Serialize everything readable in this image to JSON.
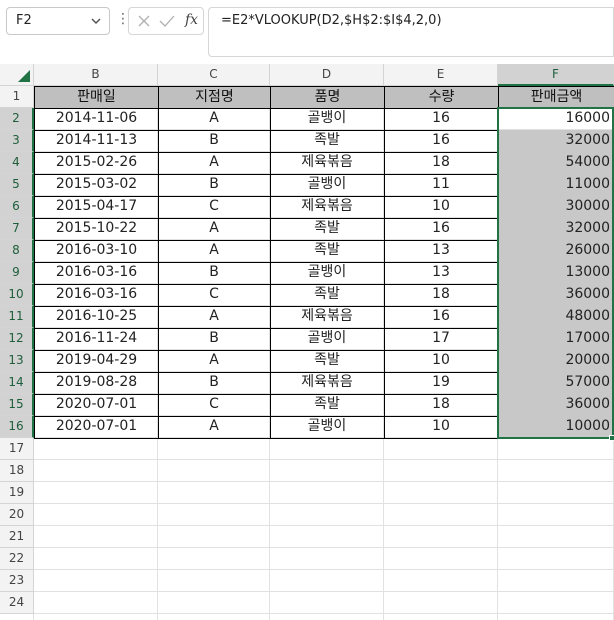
{
  "formula_bar": {
    "name_box": "F2",
    "fx": "fx",
    "formula": "=E2*VLOOKUP(D2,$H$2:$I$4,2,0)"
  },
  "columns": [
    "B",
    "C",
    "D",
    "E",
    "F"
  ],
  "row_numbers": [
    "1",
    "2",
    "3",
    "4",
    "5",
    "6",
    "7",
    "8",
    "9",
    "10",
    "11",
    "12",
    "13",
    "14",
    "15",
    "16",
    "17",
    "18",
    "19",
    "20",
    "21",
    "22",
    "23",
    "24"
  ],
  "headers": [
    "판매일",
    "지점명",
    "품명",
    "수량",
    "판매금액"
  ],
  "rows": [
    [
      "2014-11-06",
      "A",
      "골뱅이",
      "16",
      "16000"
    ],
    [
      "2014-11-13",
      "B",
      "족발",
      "16",
      "32000"
    ],
    [
      "2015-02-26",
      "A",
      "제육볶음",
      "18",
      "54000"
    ],
    [
      "2015-03-02",
      "B",
      "골뱅이",
      "11",
      "11000"
    ],
    [
      "2015-04-17",
      "C",
      "제육볶음",
      "10",
      "30000"
    ],
    [
      "2015-10-22",
      "A",
      "족발",
      "16",
      "32000"
    ],
    [
      "2016-03-10",
      "A",
      "족발",
      "13",
      "26000"
    ],
    [
      "2016-03-16",
      "B",
      "골뱅이",
      "13",
      "13000"
    ],
    [
      "2016-03-16",
      "C",
      "족발",
      "18",
      "36000"
    ],
    [
      "2016-10-25",
      "A",
      "제육볶음",
      "16",
      "48000"
    ],
    [
      "2016-11-24",
      "B",
      "골뱅이",
      "17",
      "17000"
    ],
    [
      "2019-04-29",
      "A",
      "족발",
      "10",
      "20000"
    ],
    [
      "2019-08-28",
      "B",
      "제육볶음",
      "19",
      "57000"
    ],
    [
      "2020-07-01",
      "C",
      "족발",
      "18",
      "36000"
    ],
    [
      "2020-07-01",
      "A",
      "골뱅이",
      "10",
      "10000"
    ]
  ],
  "colors": {
    "accent": "#217346",
    "header_fill": "#bfbfbf",
    "selection_fill": "#c8c8c8"
  },
  "icons": {
    "name_box_dropdown": "chevron-down-icon",
    "more": "vertical-dots-icon",
    "cancel": "close-icon",
    "enter": "check-icon",
    "insert_function": "fx-icon"
  }
}
